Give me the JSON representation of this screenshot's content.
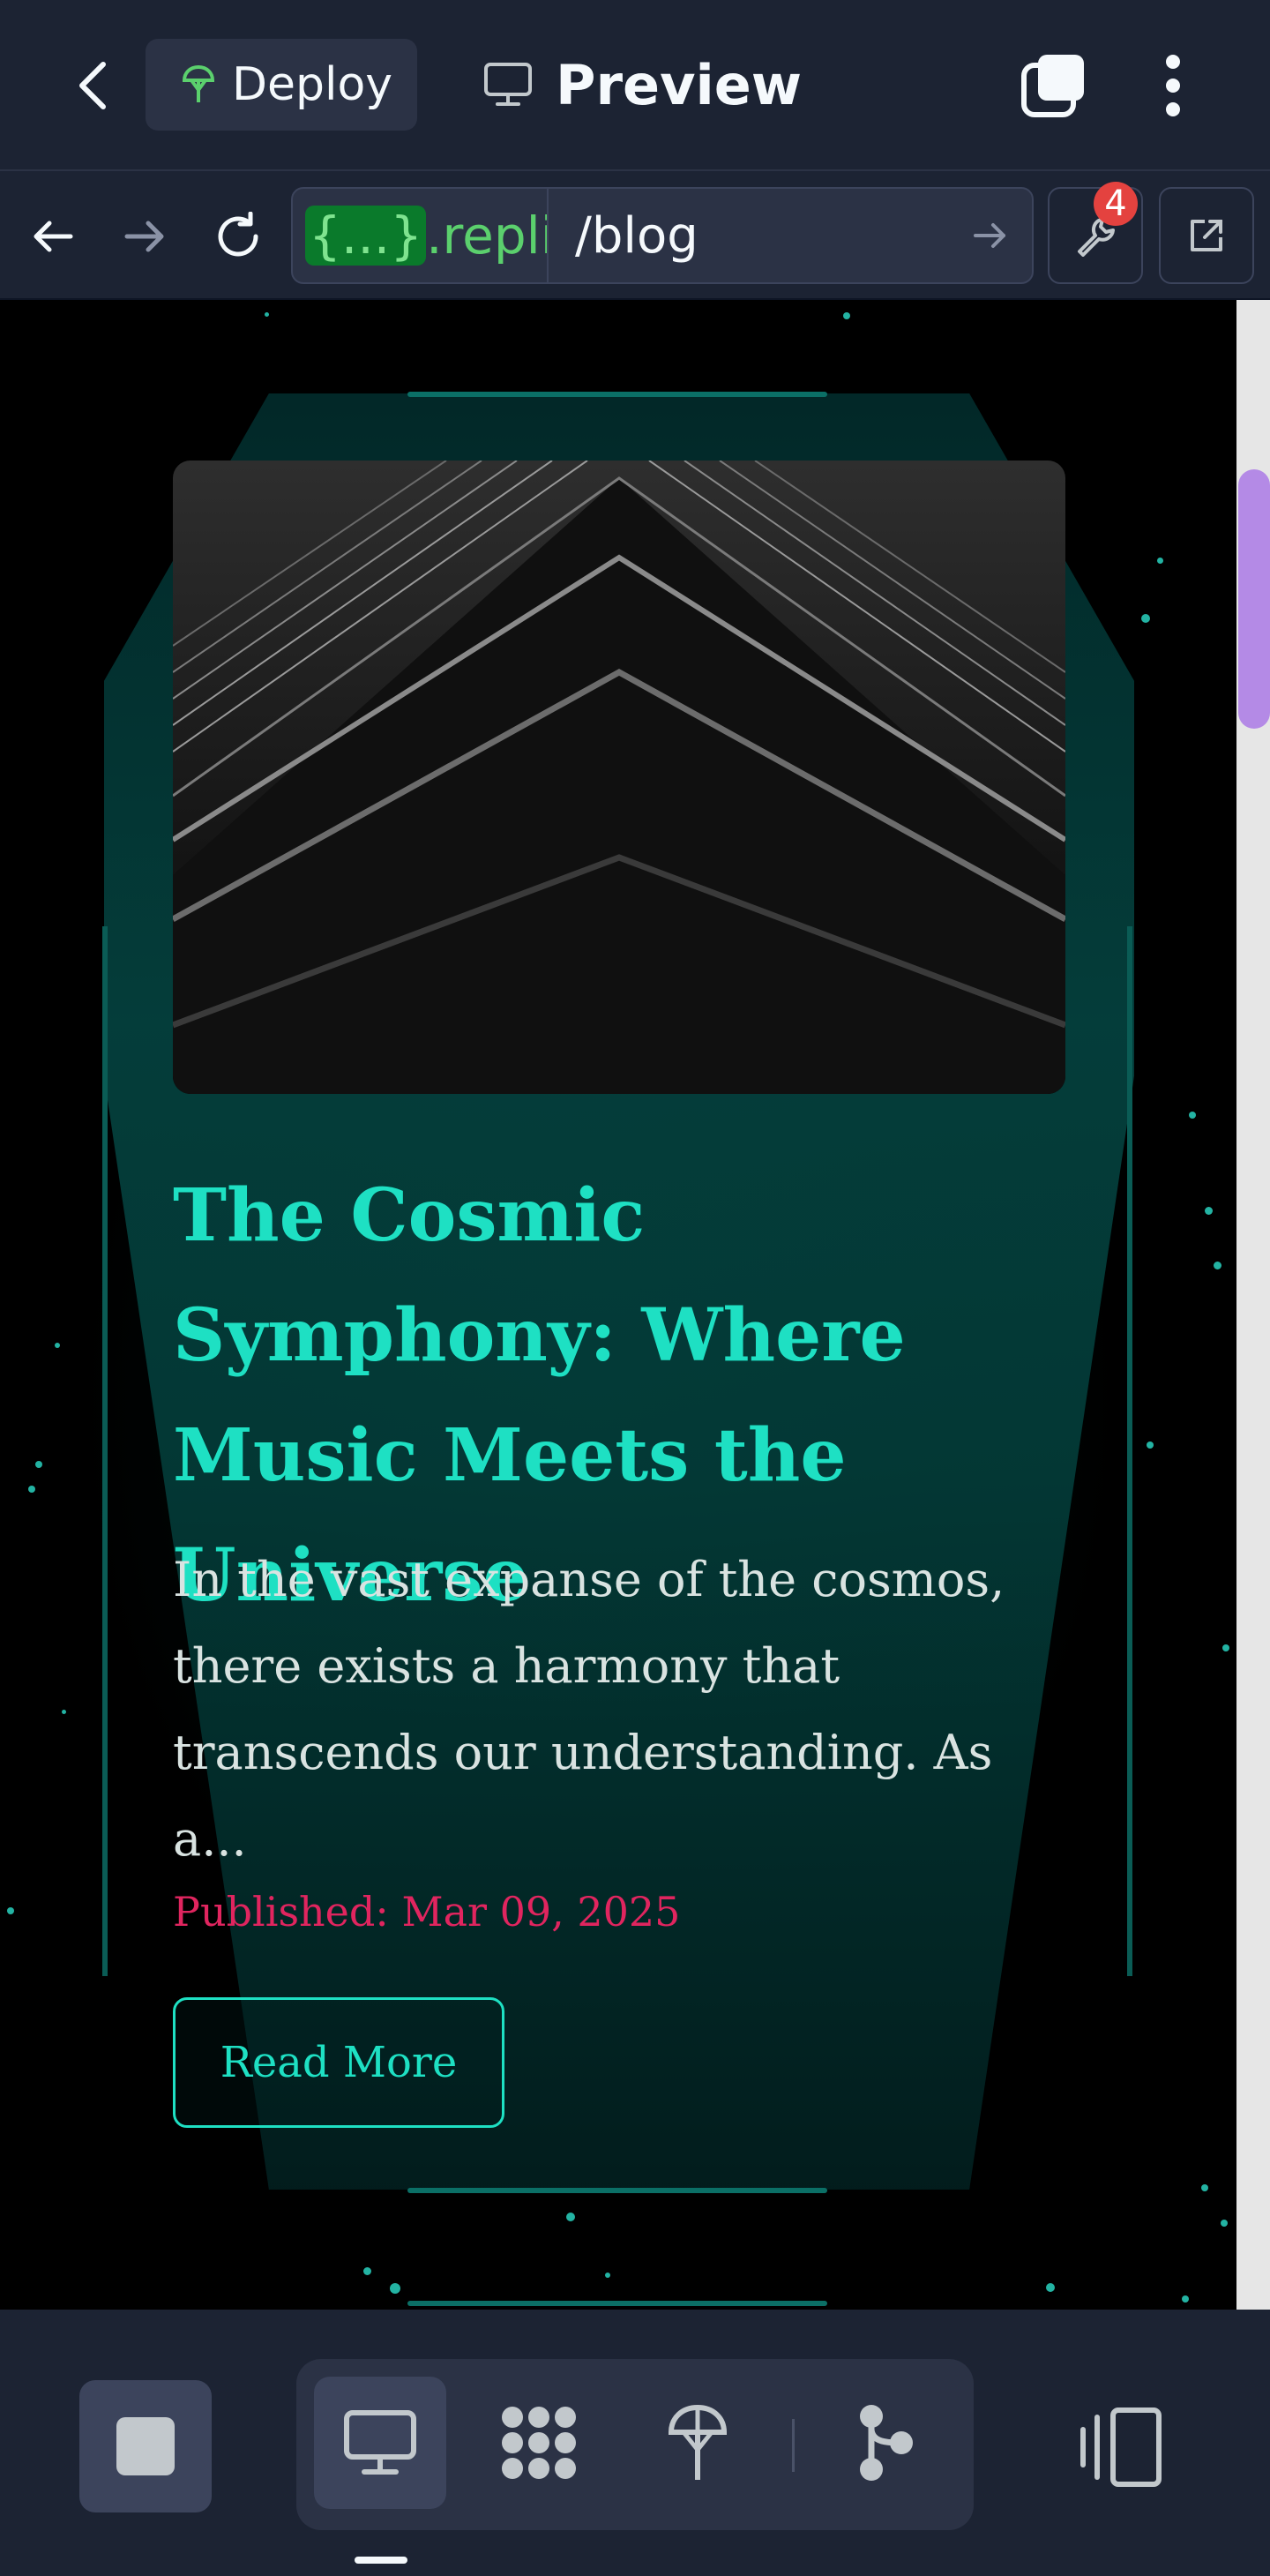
{
  "topbar": {
    "deploy_label": "Deploy",
    "preview_label": "Preview"
  },
  "browser": {
    "url_braces": "{...}",
    "url_domain": ".replit",
    "url_path": "/blog",
    "badge_count": "4"
  },
  "post": {
    "title": "The Cosmic Symphony: Where Music Meets the Universe",
    "excerpt": "In the vast expanse of the cosmos, there exists a harmony that transcends our understanding. As a...",
    "date": "Published: Mar 09, 2025",
    "read_more": "Read More"
  },
  "colors": {
    "accent_teal": "#1ee0c3",
    "date_pink": "#e0255f",
    "fab_blue": "#2b62e8",
    "chat_gradient_start": "#4d6ff0",
    "chat_gradient_end": "#7f3ae8"
  },
  "icons": [
    "back-icon",
    "deploy-icon",
    "monitor-icon",
    "tabs-icon",
    "more-icon",
    "arrow-left-icon",
    "arrow-right-icon",
    "reload-icon",
    "go-arrow-icon",
    "wrench-icon",
    "external-link-icon",
    "gear-icon",
    "stop-icon",
    "monitor-icon",
    "shapes-icon",
    "deploy-icon",
    "git-icon",
    "layout-icon"
  ]
}
